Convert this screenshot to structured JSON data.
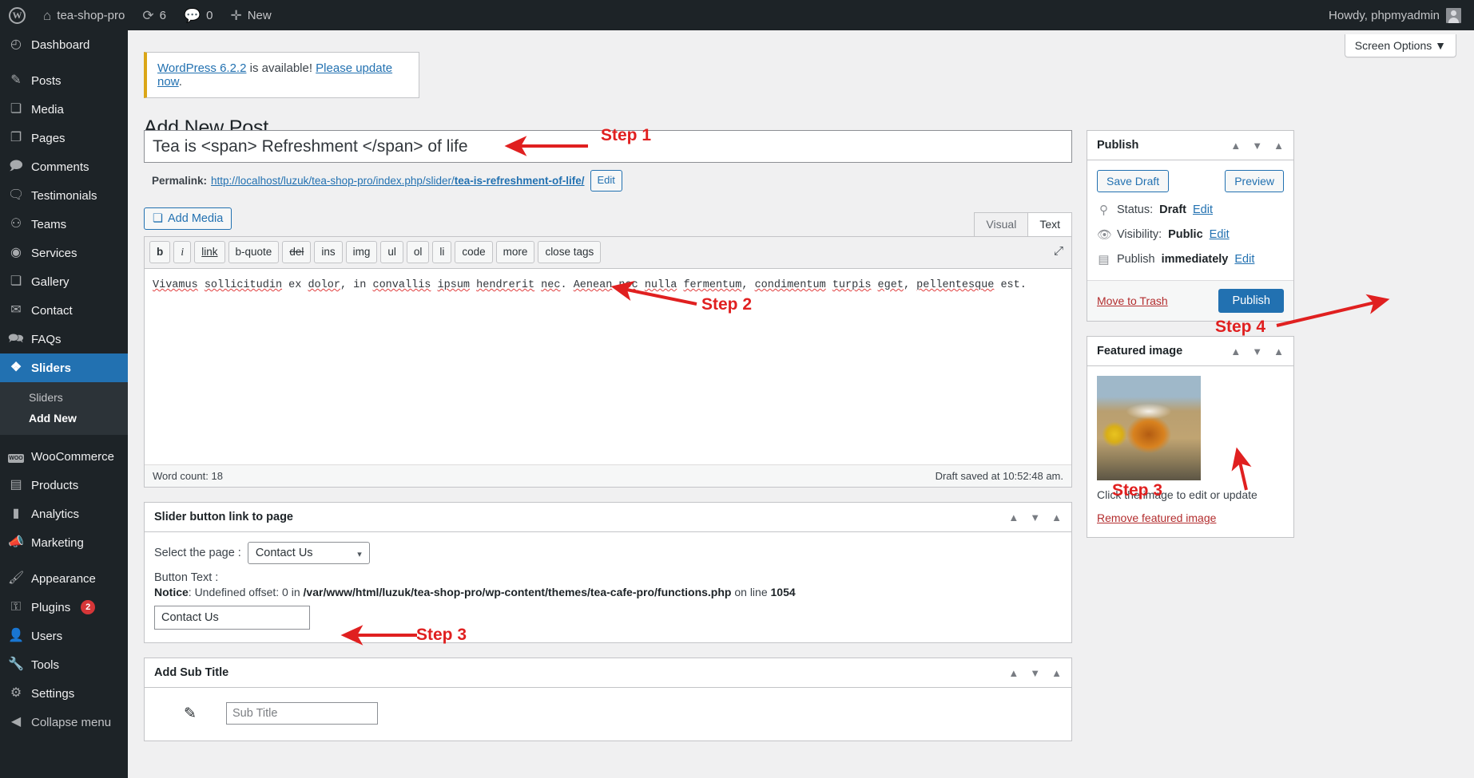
{
  "adminbar": {
    "logo_icon": "wordpress-logo-icon",
    "site_name": "tea-shop-pro",
    "updates_icon": "updates-icon",
    "updates_count": "6",
    "comments_icon": "comment-bubble-icon",
    "comments_count": "0",
    "new_icon": "plus-icon",
    "new_label": "New",
    "howdy": "Howdy, phpmyadmin",
    "avatar_icon": "user-avatar-icon"
  },
  "sidebar": {
    "items": [
      {
        "label": "Dashboard",
        "icon": "dashboard-icon",
        "current": false
      },
      {
        "label": "Posts",
        "icon": "pin-icon",
        "current": false
      },
      {
        "label": "Media",
        "icon": "media-icon",
        "current": false
      },
      {
        "label": "Pages",
        "icon": "pages-icon",
        "current": false
      },
      {
        "label": "Comments",
        "icon": "comment-bubble-icon",
        "current": false
      },
      {
        "label": "Testimonials",
        "icon": "testimonials-icon",
        "current": false
      },
      {
        "label": "Teams",
        "icon": "groups-icon",
        "current": false
      },
      {
        "label": "Services",
        "icon": "services-icon",
        "current": false
      },
      {
        "label": "Gallery",
        "icon": "media-icon",
        "current": false
      },
      {
        "label": "Contact",
        "icon": "envelope-icon",
        "current": false
      },
      {
        "label": "FAQs",
        "icon": "faq-bubble-icon",
        "current": false
      },
      {
        "label": "Sliders",
        "icon": "sliders-icon",
        "current": true
      }
    ],
    "submenu": [
      {
        "label": "Sliders",
        "active": false
      },
      {
        "label": "Add New",
        "active": true
      }
    ],
    "items2": [
      {
        "label": "WooCommerce",
        "icon": "woocommerce-icon",
        "badge": ""
      },
      {
        "label": "Products",
        "icon": "products-icon",
        "badge": ""
      },
      {
        "label": "Analytics",
        "icon": "bar-chart-icon",
        "badge": ""
      },
      {
        "label": "Marketing",
        "icon": "megaphone-icon",
        "badge": ""
      }
    ],
    "items3": [
      {
        "label": "Appearance",
        "icon": "paintbrush-icon",
        "badge": ""
      },
      {
        "label": "Plugins",
        "icon": "plug-icon",
        "badge": "2"
      },
      {
        "label": "Users",
        "icon": "user-icon",
        "badge": ""
      },
      {
        "label": "Tools",
        "icon": "wrench-icon",
        "badge": ""
      },
      {
        "label": "Settings",
        "icon": "settings-sliders-icon",
        "badge": ""
      }
    ],
    "collapse": {
      "label": "Collapse menu",
      "icon": "collapse-arrow-icon"
    }
  },
  "screen_options": {
    "label": "Screen Options",
    "caret": "▼"
  },
  "notice": {
    "link1": "WordPress 6.2.2",
    "mid": " is available! ",
    "link2": "Please update now",
    "end": "."
  },
  "page_title": "Add New Post",
  "title_field": {
    "value": "Tea is <span> Refreshment </span> of life",
    "name": "post-title"
  },
  "permalink": {
    "label": "Permalink:",
    "url_prefix": "http://localhost/luzuk/tea-shop-pro/index.php/slider/",
    "slug": "tea-is-refreshment-of-life/",
    "edit_label": "Edit"
  },
  "add_media": {
    "label": "Add Media",
    "icon": "media-icon"
  },
  "editor": {
    "tabs": [
      {
        "label": "Visual",
        "active": false
      },
      {
        "label": "Text",
        "active": true
      }
    ],
    "quicktags": [
      "b",
      "i",
      "link",
      "b-quote",
      "del",
      "ins",
      "img",
      "ul",
      "ol",
      "li",
      "code",
      "more",
      "close tags"
    ],
    "fullscreen_icon": "fullscreen-icon",
    "content": "Vivamus sollicitudin ex dolor, in convallis ipsum hendrerit nec. Aenean nec nulla fermentum, condimentum turpis eget, pellentesque est.",
    "content_tokens": [
      {
        "t": "Vivamus",
        "s": true
      },
      {
        "t": " ",
        "s": false
      },
      {
        "t": "sollicitudin",
        "s": true
      },
      {
        "t": " ex ",
        "s": false
      },
      {
        "t": "dolor",
        "s": true
      },
      {
        "t": ", in ",
        "s": false
      },
      {
        "t": "convallis",
        "s": true
      },
      {
        "t": " ",
        "s": false
      },
      {
        "t": "ipsum",
        "s": true
      },
      {
        "t": " ",
        "s": false
      },
      {
        "t": "hendrerit",
        "s": true
      },
      {
        "t": " ",
        "s": false
      },
      {
        "t": "nec",
        "s": true
      },
      {
        "t": ". ",
        "s": false
      },
      {
        "t": "Aenean",
        "s": true
      },
      {
        "t": " ",
        "s": false
      },
      {
        "t": "nec",
        "s": true
      },
      {
        "t": " ",
        "s": false
      },
      {
        "t": "nulla",
        "s": true
      },
      {
        "t": " ",
        "s": false
      },
      {
        "t": "fermentum",
        "s": true
      },
      {
        "t": ", ",
        "s": false
      },
      {
        "t": "condimentum",
        "s": true
      },
      {
        "t": " ",
        "s": false
      },
      {
        "t": "turpis",
        "s": true
      },
      {
        "t": " ",
        "s": false
      },
      {
        "t": "eget",
        "s": true
      },
      {
        "t": ", ",
        "s": false
      },
      {
        "t": "pellentesque",
        "s": true
      },
      {
        "t": " est.",
        "s": false
      }
    ],
    "word_count": "Word count: 18",
    "draft_saved": "Draft saved at 10:52:48 am."
  },
  "slider_box": {
    "title": "Slider button link to page",
    "select_label": "Select the page :",
    "select_value": "Contact Us",
    "select_options": [
      "Contact Us"
    ],
    "button_text_label": "Button Text :",
    "notice_prefix": "Notice",
    "notice_body": ": Undefined offset: 0 in ",
    "notice_path": "/var/www/html/luzuk/tea-shop-pro/wp-content/themes/tea-cafe-pro/functions.php",
    "notice_online": " on line ",
    "notice_lineno": "1054",
    "button_text_value": "Contact Us",
    "ctrl_up": "▲",
    "ctrl_down": "▼",
    "ctrl_toggle": "▲"
  },
  "subtitle_box": {
    "title": "Add Sub Title",
    "pencil_icon": "pencil-icon",
    "input_placeholder": "Sub Title",
    "input_value": ""
  },
  "publish_box": {
    "title": "Publish",
    "save_draft": "Save Draft",
    "preview": "Preview",
    "status_label": "Status:",
    "status_value": "Draft",
    "status_edit": "Edit",
    "visibility_label": "Visibility:",
    "visibility_value": "Public",
    "visibility_edit": "Edit",
    "publish_label": "Publish",
    "publish_when": "immediately",
    "publish_edit": "Edit",
    "move_to_trash": "Move to Trash",
    "publish_button": "Publish",
    "status_icon": "pin-icon",
    "visibility_icon": "eye-icon",
    "schedule_icon": "calendar-icon"
  },
  "featured_box": {
    "title": "Featured image",
    "image_alt": "cup-of-tea-thumbnail",
    "caption": "Click the image to edit or update",
    "remove_link": "Remove featured image"
  },
  "steps": [
    {
      "label": "Step 1"
    },
    {
      "label": "Step 2"
    },
    {
      "label": "Step 3"
    },
    {
      "label": "Step 4"
    },
    {
      "label": "Step 3"
    }
  ],
  "colors": {
    "accent": "#2271b1",
    "sidebar_bg": "#1d2327",
    "annotation": "#e02020",
    "notice_border": "#dba617",
    "danger": "#b32d2e"
  }
}
